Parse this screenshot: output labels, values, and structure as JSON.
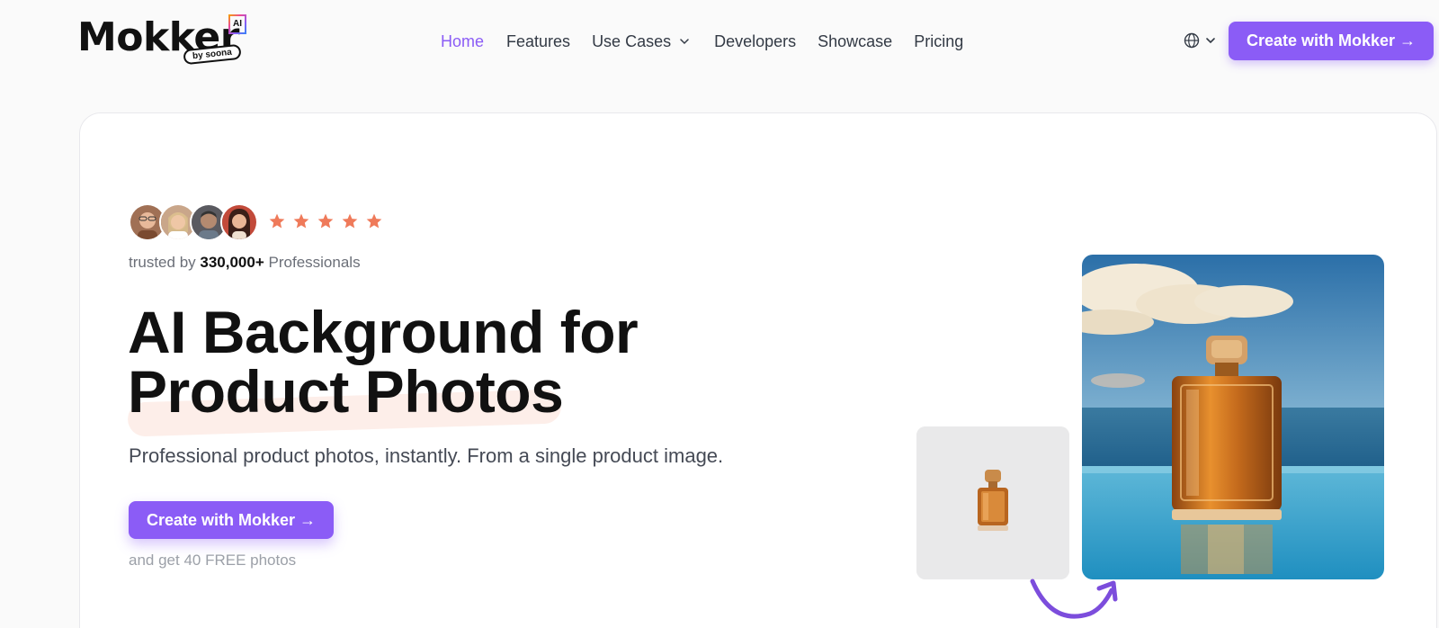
{
  "logo": {
    "word": "Mokker",
    "badge": "AI",
    "byline": "by soona"
  },
  "nav": {
    "items": [
      {
        "label": "Home",
        "active": true
      },
      {
        "label": "Features",
        "active": false
      },
      {
        "label": "Use Cases",
        "active": false,
        "has_dropdown": true
      },
      {
        "label": "Developers",
        "active": false
      },
      {
        "label": "Showcase",
        "active": false
      },
      {
        "label": "Pricing",
        "active": false
      }
    ],
    "language_icon": "globe-icon",
    "cta_label": "Create with Mokker →"
  },
  "hero": {
    "rating_stars": 5,
    "trusted_prefix": "trusted by",
    "trusted_count": "330,000+",
    "trusted_suffix": "Professionals",
    "title_line1": "AI Background for",
    "title_line2": "Product Photos",
    "subtitle": "Professional product photos, instantly. From a single product image.",
    "cta_label": "Create with Mokker →",
    "free_note": "and get 40 FREE photos"
  },
  "colors": {
    "accent": "#8b5cf6",
    "star": "#ef7a5a",
    "highlight": "#fdeee9"
  }
}
